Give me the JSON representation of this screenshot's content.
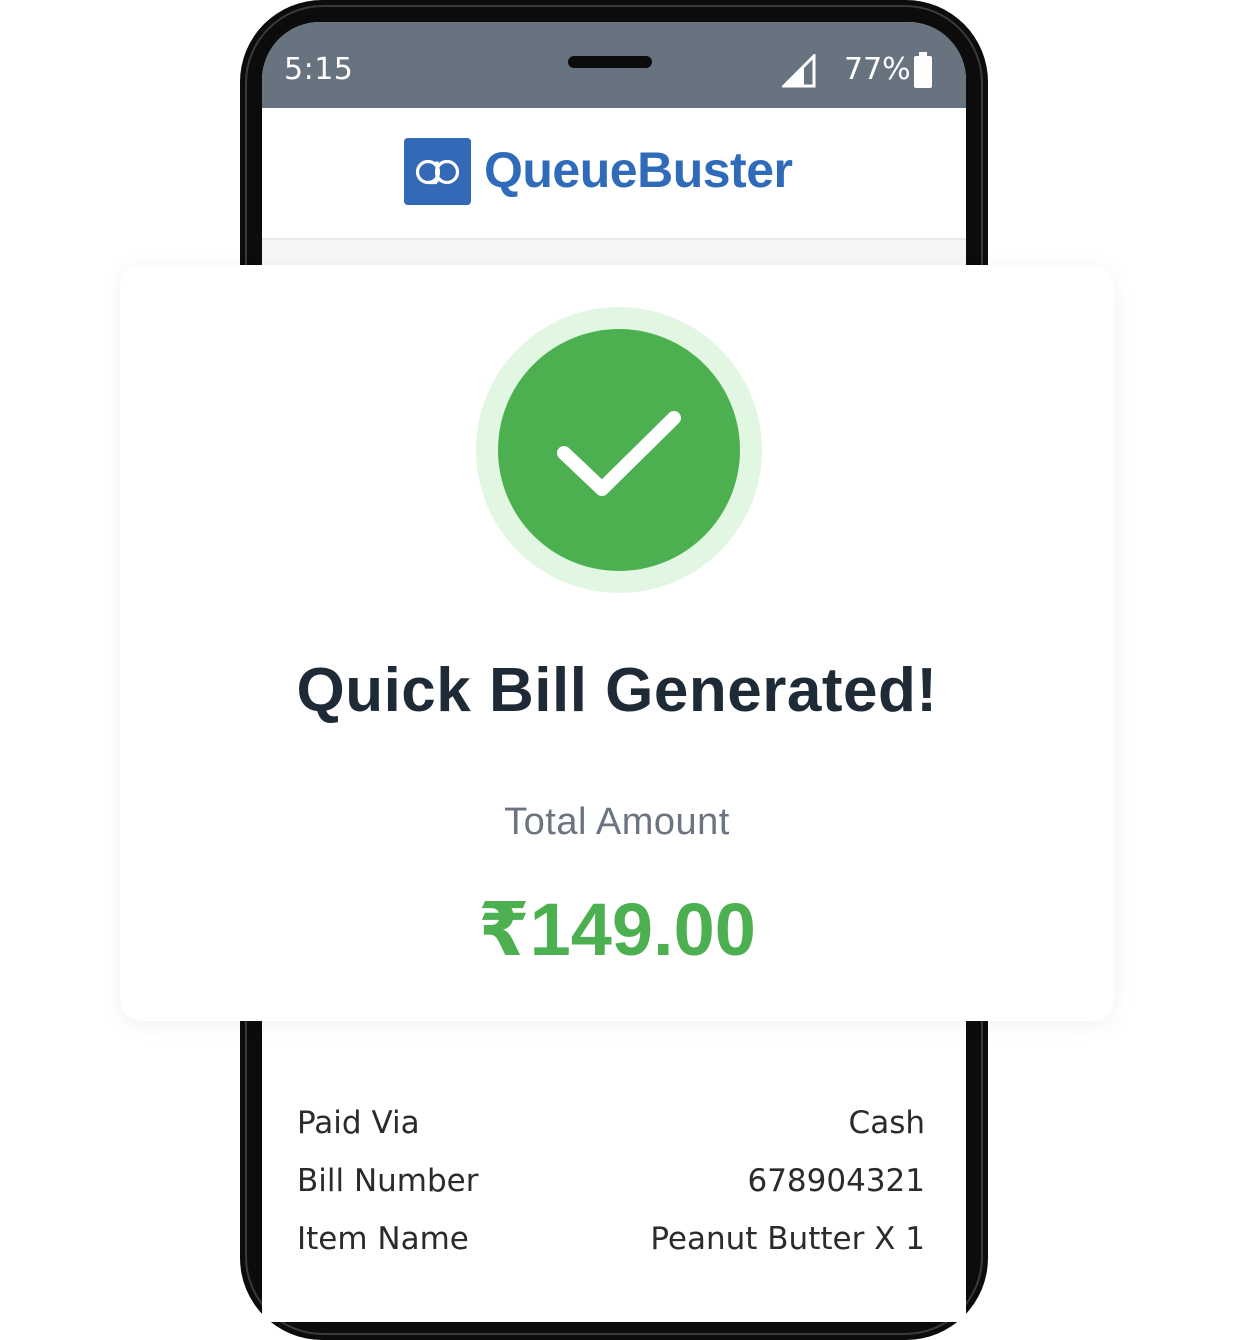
{
  "status_bar": {
    "time": "5:15",
    "battery_percent": "77%",
    "signal_icon": "signal-icon",
    "battery_icon": "battery-icon"
  },
  "header": {
    "logo_icon": "queuebuster-logo-icon",
    "brand": "QueueBuster",
    "brand_color": "#2f6bb8"
  },
  "success_card": {
    "icon": "check-icon",
    "title": "Quick Bill Generated!",
    "total_label": "Total Amount",
    "total_amount": "₹149.00",
    "accent_color": "#4caf50"
  },
  "receipt": {
    "rows": [
      {
        "label": "Paid Via",
        "value": "Cash"
      },
      {
        "label": "Bill Number",
        "value": "678904321"
      },
      {
        "label": "Item Name",
        "value": "Peanut Butter X 1"
      }
    ]
  }
}
